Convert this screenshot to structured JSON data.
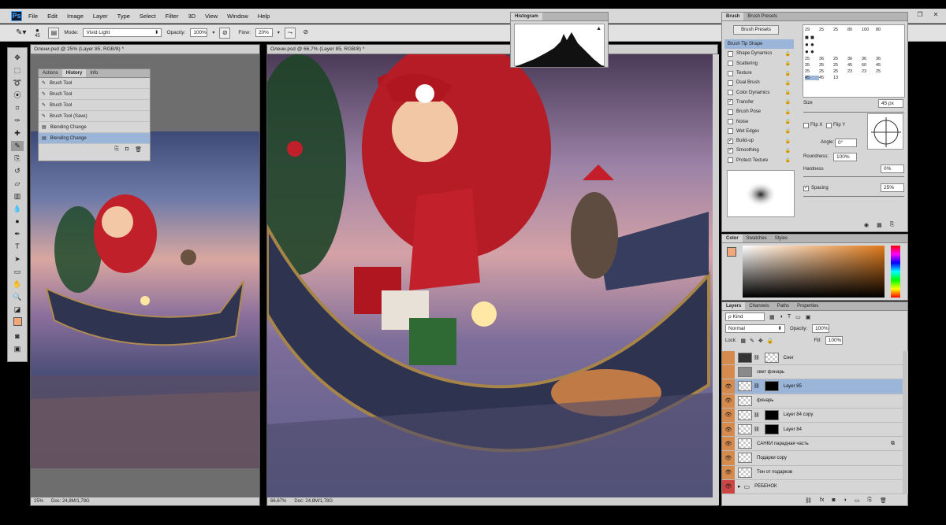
{
  "app": {
    "logo": "Ps"
  },
  "menu": [
    "File",
    "Edit",
    "Image",
    "Layer",
    "Type",
    "Select",
    "Filter",
    "3D",
    "View",
    "Window",
    "Help"
  ],
  "options": {
    "brush_size": "45",
    "mode_label": "Mode:",
    "mode_value": "Vivid Light",
    "opacity_label": "Opacity:",
    "opacity_value": "100%",
    "flow_label": "Flow:",
    "flow_value": "20%"
  },
  "doc_small": {
    "title": "Олени.psd @ 25% (Layer 85, RGB/8) *",
    "zoom": "25%",
    "doc_info": "Doc: 24,8M/1,78G"
  },
  "doc_main": {
    "title": "Олени.psd @ 66,7% (Layer 85, RGB/8) *",
    "zoom": "66,67%",
    "doc_info": "Doc: 24,8M/1,78G"
  },
  "history_panel": {
    "tabs": [
      "Actions",
      "History",
      "Info"
    ],
    "items": [
      "Brush Tool",
      "Brush Tool",
      "Brush Tool",
      "Brush Tool (Save)",
      "Blending Change",
      "Blending Change"
    ]
  },
  "histogram": {
    "title": "Histogram",
    "warning": "▲"
  },
  "brush_panel": {
    "tabs": [
      "Brush",
      "Brush Presets"
    ],
    "presets_button": "Brush Presets",
    "options": [
      {
        "label": "Brush Tip Shape",
        "checked": false,
        "tip": true
      },
      {
        "label": "Shape Dynamics",
        "checked": false
      },
      {
        "label": "Scattering",
        "checked": false
      },
      {
        "label": "Texture",
        "checked": false
      },
      {
        "label": "Dual Brush",
        "checked": false
      },
      {
        "label": "Color Dynamics",
        "checked": false
      },
      {
        "label": "Transfer",
        "checked": true
      },
      {
        "label": "Brush Pose",
        "checked": false
      },
      {
        "label": "Noise",
        "checked": false
      },
      {
        "label": "Wet Edges",
        "checked": false
      },
      {
        "label": "Build-up",
        "checked": true
      },
      {
        "label": "Smoothing",
        "checked": true
      },
      {
        "label": "Protect Texture",
        "checked": false
      }
    ],
    "tip_sizes": [
      [
        "29",
        "25",
        "25",
        "80",
        "100",
        "80"
      ],
      [
        "25",
        "36",
        "25",
        "36",
        "36",
        "36"
      ],
      [
        "35",
        "35",
        "25",
        "45",
        "60",
        "45"
      ],
      [
        "25",
        "25",
        "25",
        "23",
        "23",
        "25"
      ],
      [
        "45",
        "45",
        "13",
        "",
        "",
        ""
      ]
    ],
    "size_label": "Size",
    "size_value": "45 px",
    "flip_x": "Flip X",
    "flip_y": "Flip Y",
    "angle_label": "Angle:",
    "angle_value": "0°",
    "roundness_label": "Roundness:",
    "roundness_value": "100%",
    "hardness_label": "Hardness",
    "hardness_value": "0%",
    "spacing_label": "Spacing",
    "spacing_value": "25%"
  },
  "color_panel": {
    "tabs": [
      "Color",
      "Swatches",
      "Styles"
    ],
    "foreground": "#f2a77a"
  },
  "layers_panel": {
    "tabs": [
      "Layers",
      "Channels",
      "Paths",
      "Properties"
    ],
    "kind": "Kind",
    "blend_mode": "Normal",
    "opacity_label": "Opacity:",
    "opacity_value": "100%",
    "lock_label": "Lock:",
    "fill_label": "Fill:",
    "fill_value": "100%",
    "layers": [
      {
        "name": "Снег",
        "visible": false,
        "thumb": "dark",
        "mask": true
      },
      {
        "name": "свет фонарь",
        "visible": false,
        "thumb": "gray",
        "mask": false
      },
      {
        "name": "Layer 85",
        "visible": true,
        "thumb": "checker",
        "mask": true,
        "selected": true
      },
      {
        "name": "фонарь",
        "visible": true,
        "thumb": "checker",
        "mask": false
      },
      {
        "name": "Layer 84 copy",
        "visible": true,
        "thumb": "checker",
        "mask": true
      },
      {
        "name": "Layer 84",
        "visible": true,
        "thumb": "checker",
        "mask": true
      },
      {
        "name": "САНКИ парадная часть",
        "visible": true,
        "thumb": "checker",
        "mask": false
      },
      {
        "name": "Подарки copy",
        "visible": true,
        "thumb": "checker",
        "mask": false
      },
      {
        "name": "Тен от подарков",
        "visible": true,
        "thumb": "checker",
        "mask": false
      },
      {
        "name": "РЕБЕНОК",
        "visible": true,
        "thumb": "folder",
        "mask": false,
        "group": true
      }
    ]
  }
}
